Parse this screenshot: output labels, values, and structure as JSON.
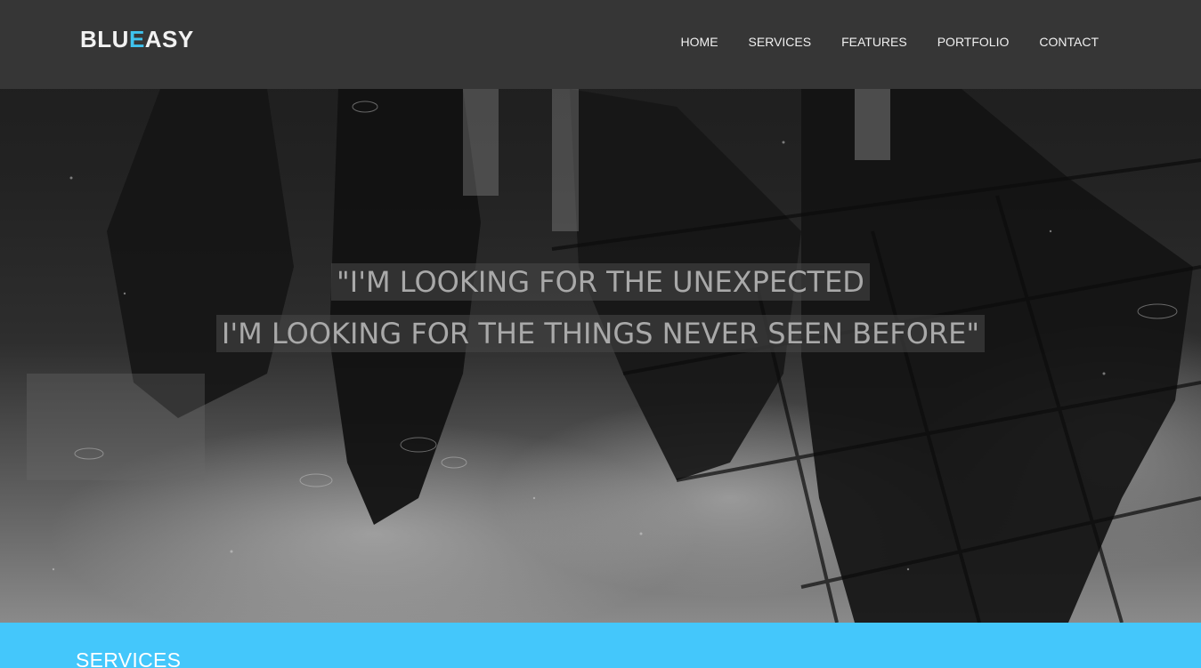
{
  "brand": {
    "logo_part1": "BLU",
    "logo_accent": "E",
    "logo_part2": "ASY",
    "accent_color": "#3fc3ee"
  },
  "nav": {
    "items": [
      {
        "label": "HOME"
      },
      {
        "label": "SERVICES"
      },
      {
        "label": "FEATURES"
      },
      {
        "label": "PORTFOLIO"
      },
      {
        "label": "CONTACT"
      }
    ]
  },
  "hero": {
    "quote_line1": "\"I'M LOOKING FOR THE UNEXPECTED",
    "quote_line2": "I'M LOOKING FOR THE THINGS NEVER SEEN BEFORE\""
  },
  "services": {
    "title": "SERVICES",
    "band_color": "#44c7fb"
  }
}
